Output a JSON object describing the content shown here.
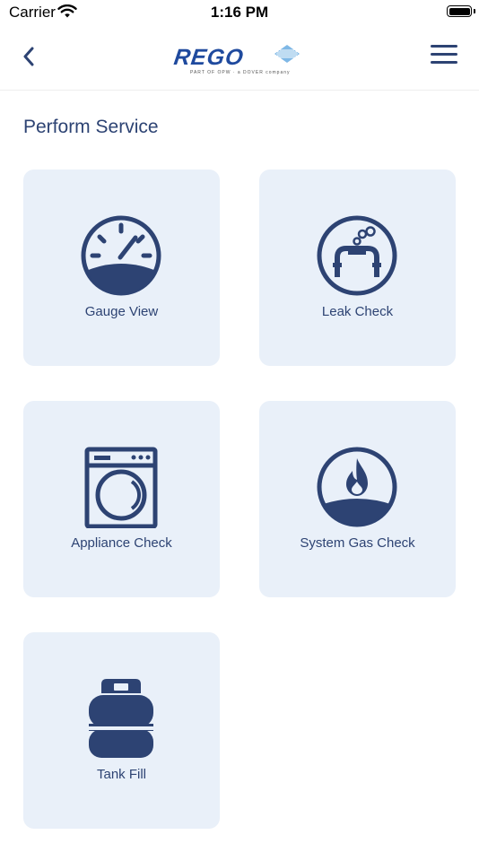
{
  "status_bar": {
    "carrier": "Carrier",
    "time": "1:16 PM"
  },
  "header": {
    "back_icon": "chevron-left-icon",
    "logo": {
      "brand": "REGO",
      "tagline": "PART OF OPW · a DOVER company"
    },
    "menu_icon": "hamburger-menu-icon"
  },
  "page": {
    "title": "Perform Service"
  },
  "tiles": [
    {
      "label": "Gauge View",
      "icon": "gauge-icon"
    },
    {
      "label": "Leak Check",
      "icon": "leak-check-icon"
    },
    {
      "label": "Appliance Check",
      "icon": "washing-machine-icon"
    },
    {
      "label": "System Gas Check",
      "icon": "gas-flame-icon"
    },
    {
      "label": "Tank Fill",
      "icon": "propane-tank-icon"
    }
  ],
  "colors": {
    "primary": "#2d4373",
    "tile_background": "#e9f0f9",
    "logo_blue": "#1f4a9e"
  }
}
